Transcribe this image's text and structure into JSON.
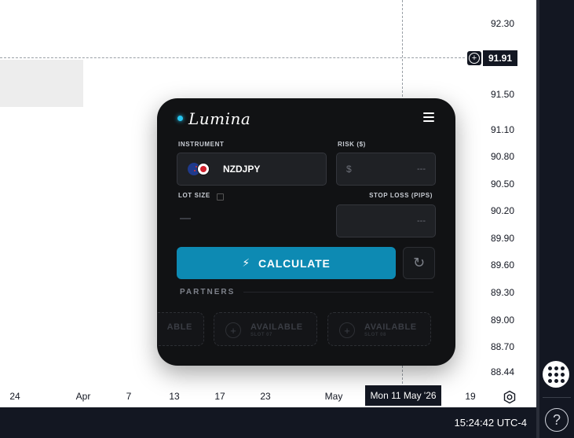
{
  "chart": {
    "price_ticks": [
      "92.30",
      "91.50",
      "91.10",
      "90.80",
      "90.50",
      "90.20",
      "89.90",
      "89.60",
      "89.30",
      "89.00",
      "88.70",
      "88.44"
    ],
    "current_price": "91.91",
    "time_ticks": [
      "24",
      "Apr",
      "7",
      "13",
      "17",
      "23",
      "May",
      "19"
    ],
    "time_cursor": "Mon 11 May '26",
    "crosshair_icon": "plus-circle-icon",
    "settings_icon": "gear-icon"
  },
  "status_bar": {
    "clock": "15:24:42 UTC-4"
  },
  "right_panel": {
    "apps_icon": "grid-dots-icon",
    "help_icon": "question-mark-icon",
    "help_glyph": "?"
  },
  "widget": {
    "brand": "Lumina",
    "accent_color": "#0d8ab3",
    "menu_icon": "hamburger-icon",
    "instrument_label": "INSTRUMENT",
    "instrument_value": "NZDJPY",
    "risk_label": "RISK ($)",
    "risk_prefix": "$",
    "risk_value": "---",
    "lot_size_label": "LOT SIZE",
    "stop_loss_label": "STOP LOSS (PIPS)",
    "stop_loss_value": "---",
    "calculate_label": "CALCULATE",
    "partners_label": "PARTNERS",
    "slots": [
      {
        "title": "ABLE",
        "sub": ""
      },
      {
        "title": "AVAILABLE",
        "sub": "SLOT 07"
      },
      {
        "title": "AVAILABLE",
        "sub": "SLOT 08"
      }
    ]
  }
}
